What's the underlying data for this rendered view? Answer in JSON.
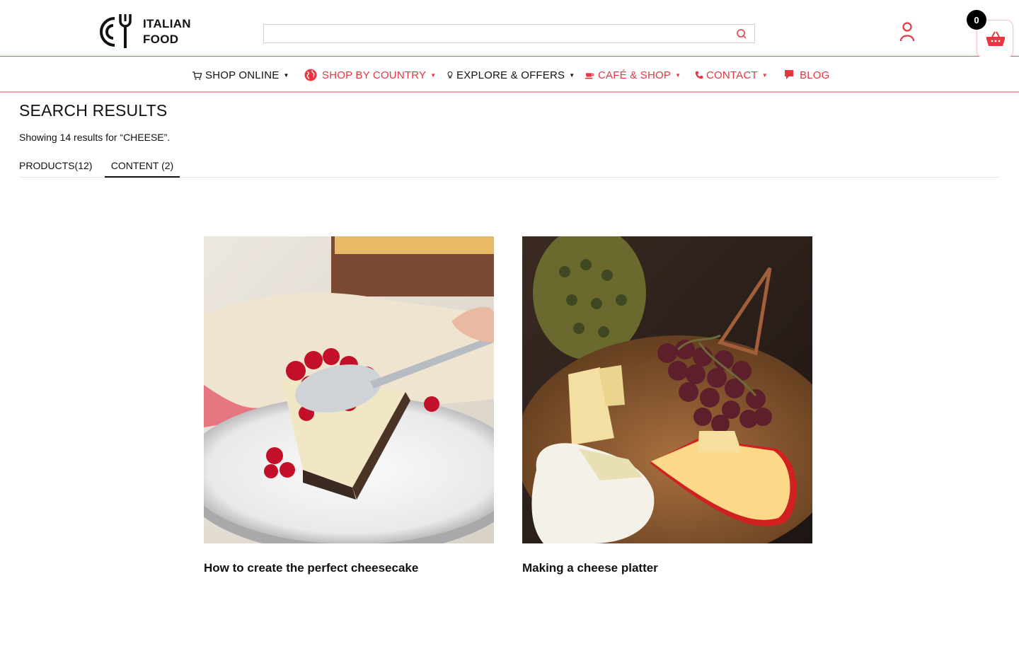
{
  "brand": {
    "name_line1": "ITALIAN",
    "name_line2": "FOOD"
  },
  "search": {
    "value": "",
    "placeholder": ""
  },
  "cart": {
    "count": "0"
  },
  "nav": {
    "items": [
      {
        "label": "SHOP ONLINE",
        "icon": "cart-icon",
        "has_dropdown": true,
        "color": "#111111"
      },
      {
        "label": "SHOP BY COUNTRY",
        "icon": "globe-icon",
        "has_dropdown": true,
        "color": "#e8353f"
      },
      {
        "label": "EXPLORE & OFFERS",
        "icon": "lightbulb-icon",
        "has_dropdown": true,
        "color": "#111111"
      },
      {
        "label": "CAFÉ & SHOP",
        "icon": "coffee-cup-icon",
        "has_dropdown": true,
        "color": "#e8353f"
      },
      {
        "label": "CONTACT",
        "icon": "phone-icon",
        "has_dropdown": true,
        "color": "#e8353f"
      },
      {
        "label": "BLOG",
        "icon": "speech-bubble-icon",
        "has_dropdown": false,
        "color": "#e8353f"
      }
    ]
  },
  "results": {
    "title": "SEARCH RESULTS",
    "summary": "Showing 14 results for “CHEESE”.",
    "tabs": [
      {
        "label": "PRODUCTS(12)",
        "active": false
      },
      {
        "label": "CONTENT (2)",
        "active": true
      }
    ],
    "cards": [
      {
        "title": "How to create the perfect cheesecake",
        "image": "cheesecake-slice-with-berries-photo"
      },
      {
        "title": "Making a cheese platter",
        "image": "cheese-board-with-grapes-photo"
      }
    ]
  },
  "colors": {
    "accent": "#e8353f",
    "border_accent": "#f0a7ad",
    "text": "#111111"
  }
}
